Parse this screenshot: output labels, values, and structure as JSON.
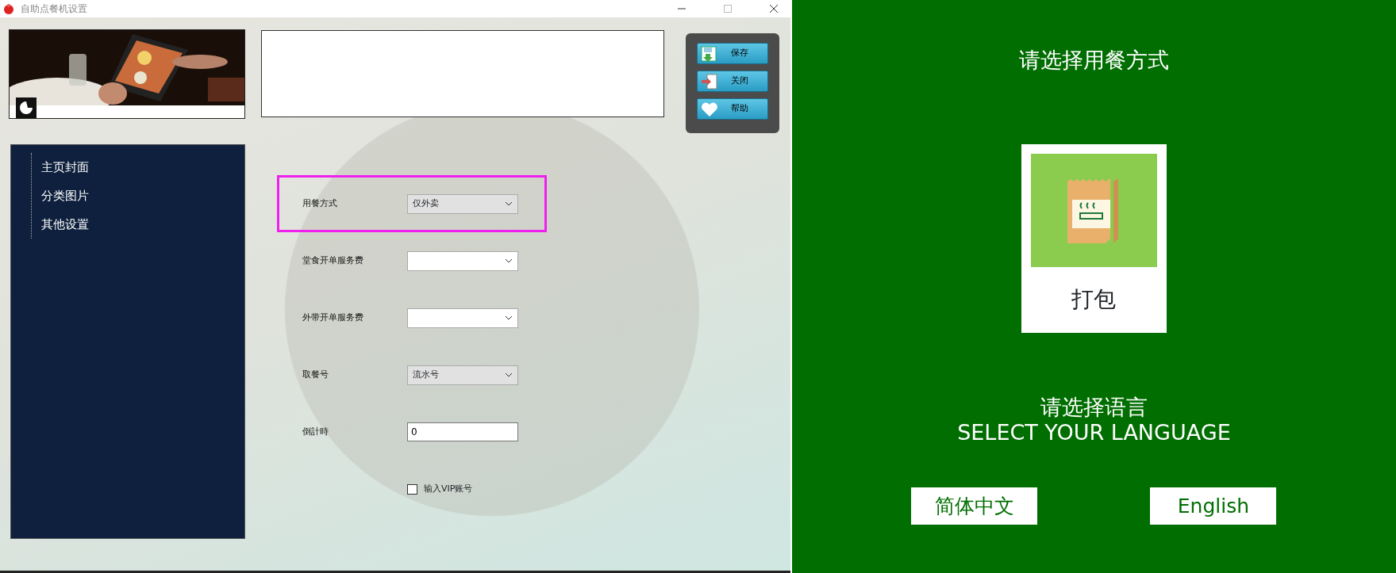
{
  "window": {
    "title": "自助点餐机设置"
  },
  "toolbar_buttons": [
    {
      "label": "保存",
      "kind": "save"
    },
    {
      "label": "关闭",
      "kind": "close"
    },
    {
      "label": "帮助",
      "kind": "help"
    }
  ],
  "sidebar": {
    "items": [
      {
        "label": "主页封面"
      },
      {
        "label": "分类图片"
      },
      {
        "label": "其他设置"
      }
    ]
  },
  "form": {
    "rows": [
      {
        "kind": "select",
        "label": "用餐方式",
        "value": "仅外卖",
        "highlighted": true
      },
      {
        "kind": "combo",
        "label": "堂食开单服务费",
        "highlighted": false
      },
      {
        "kind": "combo",
        "label": "外带开单服务费",
        "highlighted": false
      },
      {
        "kind": "select",
        "label": "取餐号",
        "value": "流水号",
        "highlighted": false
      },
      {
        "kind": "text",
        "label": "倒計時",
        "value": "0",
        "highlighted": false
      },
      {
        "kind": "checkbox",
        "label": "输入VIP账号",
        "checked": false,
        "highlighted": false
      }
    ]
  },
  "preview": {
    "title": "请选择用餐方式",
    "options": [
      {
        "label": "打包"
      }
    ],
    "language_title": "请选择语言",
    "language_subtitle": "SELECT YOUR LANGUAGE",
    "language_buttons": [
      {
        "label": "简体中文"
      },
      {
        "label": "English"
      }
    ]
  }
}
